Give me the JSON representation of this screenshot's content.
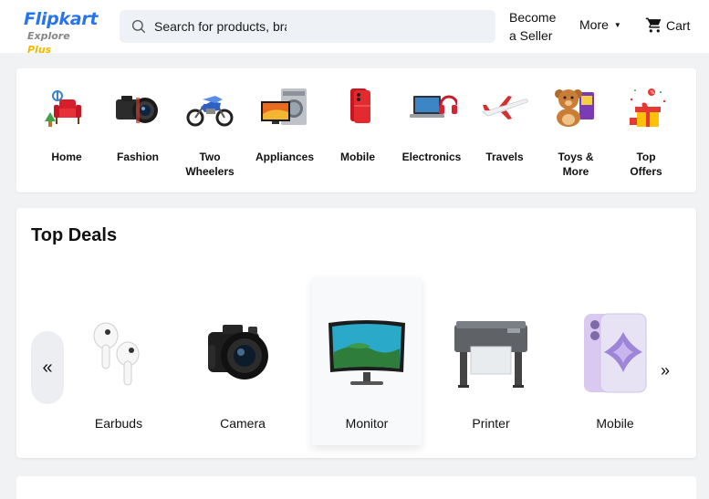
{
  "header": {
    "logo_main": "Flipkart",
    "logo_sub": "Explore",
    "logo_plus": "Plus",
    "search_placeholder": "Search for products, brands and more",
    "seller_line1": "Become",
    "seller_line2": "a Seller",
    "more_label": "More",
    "cart_label": "Cart"
  },
  "categories": [
    {
      "line1": "Home",
      "line2": ""
    },
    {
      "line1": "Fashion",
      "line2": ""
    },
    {
      "line1": "Two",
      "line2": "Wheelers"
    },
    {
      "line1": "Appliances",
      "line2": ""
    },
    {
      "line1": "Mobile",
      "line2": ""
    },
    {
      "line1": "Electronics",
      "line2": ""
    },
    {
      "line1": "Travels",
      "line2": ""
    },
    {
      "line1": "Toys &",
      "line2": "More"
    },
    {
      "line1": "Top",
      "line2": "Offers"
    }
  ],
  "deals": {
    "title": "Top Deals",
    "prev": "«",
    "next": "»",
    "items": [
      {
        "label": "Earbuds"
      },
      {
        "label": "Camera"
      },
      {
        "label": "Monitor"
      },
      {
        "label": "Printer"
      },
      {
        "label": "Mobile"
      }
    ]
  },
  "colors": {
    "brand": "#2874f0",
    "plus": "#f5b800"
  }
}
